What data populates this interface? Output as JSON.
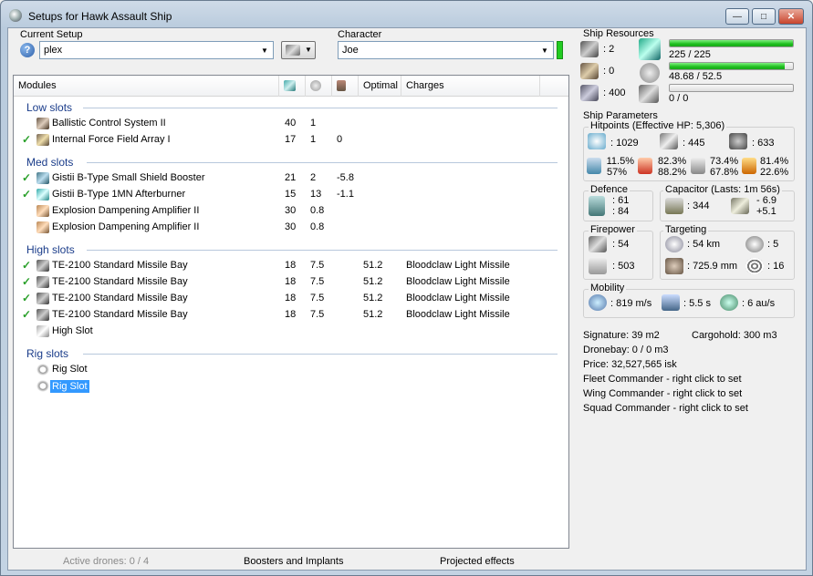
{
  "window": {
    "title": "Setups for Hawk Assault Ship",
    "min": "—",
    "max": "□",
    "close": "✕"
  },
  "setup": {
    "label": "Current Setup",
    "value": "plex"
  },
  "character": {
    "label": "Character",
    "value": "Joe"
  },
  "columns": {
    "modules": "Modules",
    "optimal": "Optimal",
    "charges": "Charges"
  },
  "sections": {
    "low": "Low slots",
    "med": "Med slots",
    "high": "High slots",
    "rig": "Rig slots"
  },
  "modules": [
    {
      "name": "Ballistic Control System II",
      "a": "40",
      "b": "1",
      "c": "",
      "opt": "",
      "charge": "",
      "on": false
    },
    {
      "name": "Internal Force Field Array I",
      "a": "17",
      "b": "1",
      "c": "0",
      "opt": "",
      "charge": "",
      "on": true
    },
    {
      "name": "Gistii B-Type Small Shield Booster",
      "a": "21",
      "b": "2",
      "c": "-5.8",
      "opt": "",
      "charge": "",
      "on": true
    },
    {
      "name": "Gistii B-Type 1MN Afterburner",
      "a": "15",
      "b": "13",
      "c": "-1.1",
      "opt": "",
      "charge": "",
      "on": true
    },
    {
      "name": "Explosion Dampening Amplifier II",
      "a": "30",
      "b": "0.8",
      "c": "",
      "opt": "",
      "charge": "",
      "on": false
    },
    {
      "name": "Explosion Dampening Amplifier II",
      "a": "30",
      "b": "0.8",
      "c": "",
      "opt": "",
      "charge": "",
      "on": false
    },
    {
      "name": "TE-2100 Standard Missile Bay",
      "a": "18",
      "b": "7.5",
      "c": "",
      "opt": "51.2",
      "charge": "Bloodclaw Light Missile",
      "on": true
    },
    {
      "name": "TE-2100 Standard Missile Bay",
      "a": "18",
      "b": "7.5",
      "c": "",
      "opt": "51.2",
      "charge": "Bloodclaw Light Missile",
      "on": true
    },
    {
      "name": "TE-2100 Standard Missile Bay",
      "a": "18",
      "b": "7.5",
      "c": "",
      "opt": "51.2",
      "charge": "Bloodclaw Light Missile",
      "on": true
    },
    {
      "name": "TE-2100 Standard Missile Bay",
      "a": "18",
      "b": "7.5",
      "c": "",
      "opt": "51.2",
      "charge": "Bloodclaw Light Missile",
      "on": true
    },
    {
      "name": "High Slot",
      "a": "",
      "b": "",
      "c": "",
      "opt": "",
      "charge": "",
      "on": false
    },
    {
      "name": "Rig Slot",
      "a": "",
      "b": "",
      "c": "",
      "opt": "",
      "charge": "",
      "on": false
    },
    {
      "name": "Rig Slot",
      "a": "",
      "b": "",
      "c": "",
      "opt": "",
      "charge": "",
      "on": false
    }
  ],
  "status": {
    "drones": "Active drones: 0 / 4",
    "boosters": "Boosters and Implants",
    "projected": "Projected effects"
  },
  "resources": {
    "label": "Ship Resources",
    "turrets": ": 2",
    "launchers": ": 0",
    "calib": ": 400",
    "cpu": "225 / 225",
    "cpu_pct": 100,
    "pg": "48.68 / 52.5",
    "pg_pct": 93,
    "drone": "0 / 0",
    "drone_pct": 0
  },
  "params": {
    "label": "Ship Parameters",
    "hp_label": "Hitpoints (Effective HP: 5,306)",
    "shield": ": 1029",
    "armor": ": 445",
    "hull": ": 633",
    "r1a": "11.5%",
    "r1b": "57%",
    "r2a": "82.3%",
    "r2b": "88.2%",
    "r3a": "73.4%",
    "r3b": "67.8%",
    "r4a": "81.4%",
    "r4b": "22.6%",
    "defence": "Defence",
    "def1": ": 61",
    "def2": ": 84",
    "cap_label": "Capacitor (Lasts: 1m 56s)",
    "cap": ": 344",
    "cap1": "- 6.9",
    "cap2": "+5.1",
    "fire_label": "Firepower",
    "fire1": ": 54",
    "fire2": ": 503",
    "tgt_label": "Targeting",
    "range": ": 54 km",
    "targets": ": 5",
    "scan": ": 725.9 mm",
    "sigres": ": 16",
    "mob_label": "Mobility",
    "speed": ": 819 m/s",
    "align": ": 5.5 s",
    "warp": ": 6 au/s",
    "signature": "Signature: 39 m2",
    "cargo": "Cargohold: 300 m3",
    "dronebay": "Dronebay: 0 / 0 m3",
    "price": "Price: 32,527,565 isk",
    "fleet": "Fleet Commander - right click to set",
    "wing": "Wing Commander - right click to set",
    "squad": "Squad Commander - right click to set"
  }
}
